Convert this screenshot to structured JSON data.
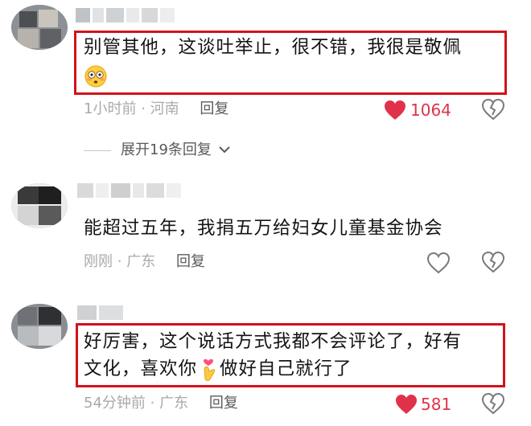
{
  "comments": [
    {
      "text_line1": "别管其他，这谈吐举止，很不错，我很是敬佩",
      "emoji_line2": "flushed-face-emoji",
      "time": "1小时前",
      "sep": "·",
      "location": "河南",
      "reply": "回复",
      "likes": "1064",
      "liked": true,
      "highlighted": true
    },
    {
      "text_line1": "能超过五年，我捐五万给妇女儿童基金协会",
      "time": "刚刚",
      "sep": "·",
      "location": "广东",
      "reply": "回复",
      "likes": "",
      "liked": false,
      "highlighted": false
    },
    {
      "text_line1": "好厉害，这个说话方式我都不会评论了，好有",
      "text_line2_a": "文化，喜欢你",
      "emoji_line2": "finger-heart-emoji",
      "text_line2_b": "做好自己就行了",
      "time": "54分钟前",
      "sep": "·",
      "location": "广东",
      "reply": "回复",
      "likes": "581",
      "liked": true,
      "highlighted": true
    }
  ],
  "expand_replies": "展开19条回复",
  "colors": {
    "highlight_border": "#d1131c",
    "like_red": "#e0324a",
    "meta_gray": "#a9a9ad"
  }
}
